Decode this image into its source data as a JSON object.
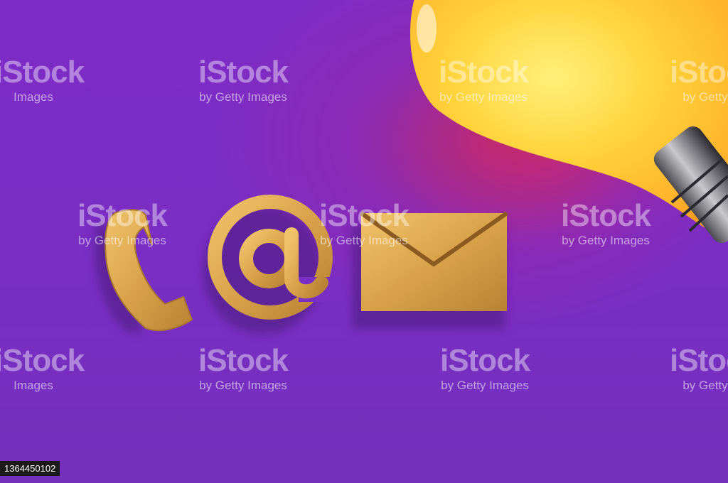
{
  "image": {
    "description_colors": {
      "background": "#7b2ec4",
      "gold": "#d9a24a",
      "bulb": "#ffd13a"
    }
  },
  "watermark": {
    "brand": "iStock",
    "credit": "by Getty Images",
    "credit_short": "by Getty",
    "credit_left": "Images",
    "trademark": "™"
  },
  "asset_id": "1364450102",
  "icons": [
    "phone-icon",
    "at-sign-icon",
    "envelope-icon",
    "light-bulb-icon"
  ]
}
